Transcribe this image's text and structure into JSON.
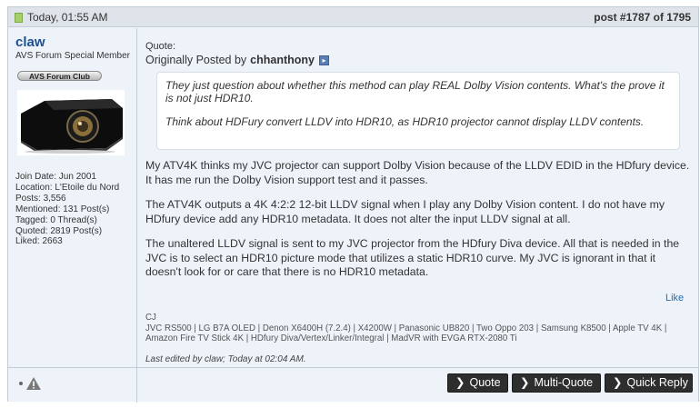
{
  "header": {
    "date": "Today, 01:55 AM",
    "post_number": "post #1787 of 1795"
  },
  "user": {
    "name": "claw",
    "title": "AVS Forum Special Member",
    "badge": "AVS Forum Club",
    "stats": [
      "Join Date: Jun 2001",
      "Location: L'Etoile du Nord",
      "Posts: 3,556",
      "Mentioned: 131 Post(s)",
      "Tagged: 0 Thread(s)",
      "Quoted: 2819 Post(s)",
      "Liked: 2663"
    ]
  },
  "quote": {
    "label": "Quote:",
    "originally_posted_by": "Originally Posted by",
    "author": "chhanthony",
    "paragraphs": [
      "They just question about whether this method can play REAL Dolby Vision contents. What's the prove it is not just HDR10.",
      "Think about HDFury convert LLDV into HDR10, as HDR10 projector cannot display LLDV contents."
    ]
  },
  "body": {
    "paragraphs": [
      "My ATV4K thinks my JVC projector can support Dolby Vision because of the LLDV EDID in the HDfury device. It has me run the Dolby Vision support test and it passes.",
      "The ATV4K outputs a 4K 4:2:2 12-bit LLDV signal when I play any Dolby Vision content. I do not have my HDfury device add any HDR10 metadata. It does not alter the input LLDV signal at all.",
      "The unaltered LLDV signal is sent to my JVC projector from the HDfury Diva device. All that is needed in the JVC is to select an HDR10 picture mode that utilizes a static HDR10 curve. My JVC is ignorant in that it doesn't look for or care that there is no HDR10 metadata."
    ]
  },
  "like_label": "Like",
  "signature": {
    "line1": "CJ",
    "line2": "JVC RS500 | LG B7A OLED | Denon X6400H (7.2.4) | X4200W | Panasonic UB820 | Two Oppo 203 | Samsung K8500 | Apple TV 4K | Amazon Fire TV Stick 4K | HDfury Diva/Vertex/Linker/Integral | MadVR with EVGA RTX-2080 Ti"
  },
  "last_edited": "Last edited by claw; Today at 02:04 AM.",
  "buttons": {
    "quote": "Quote",
    "multi_quote": "Multi-Quote",
    "quick_reply": "Quick Reply"
  },
  "icons": {
    "date": "document-icon",
    "view_post": "view-post-icon",
    "report": "warning-icon"
  },
  "colors": {
    "username": "#1d4f91",
    "link": "#1d6fb8",
    "button_bg": "#2e2e2e",
    "post_bg": "#eef3fa"
  }
}
